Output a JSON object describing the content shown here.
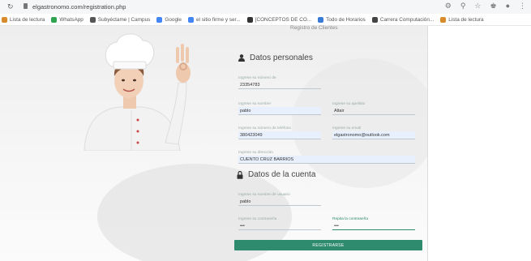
{
  "browser": {
    "url": "elgastronomo.com/registration.php",
    "bookmarks": [
      {
        "label": "Lista de lectura",
        "color": "#d98b2b"
      },
      {
        "label": "WhatsApp",
        "color": "#2ea44f"
      },
      {
        "label": "Subyéctame | Campus",
        "color": "#555555"
      },
      {
        "label": "Google",
        "color": "#4285f4"
      },
      {
        "label": "el sitio firme y ser...",
        "color": "#4285f4"
      },
      {
        "label": "[CONCEPTOS DE CO...",
        "color": "#333333"
      },
      {
        "label": "Todo de Horarios",
        "color": "#3a7bd5"
      },
      {
        "label": "Carrera Computación...",
        "color": "#444444"
      },
      {
        "label": "Lista de lectura",
        "color": "#d98b2b"
      }
    ]
  },
  "page": {
    "heading": "Registro de Clientes"
  },
  "form": {
    "personal": {
      "title": "Datos personales",
      "fields": [
        {
          "label": "Ingrese su número de",
          "value": "23354783"
        },
        {
          "label": "Ingrese su nombre",
          "value": "pablo"
        },
        {
          "label": "Ingrese su apellido",
          "value": "Altair"
        },
        {
          "label": "Ingrese su número de teléfono",
          "value": "380423049"
        },
        {
          "label": "Ingrese su email",
          "value": "elgastronomo@outlook.com"
        },
        {
          "label": "Ingrese su dirección",
          "value": "CUENTO CRUZ BARRIOS"
        }
      ]
    },
    "account": {
      "title": "Datos de la cuenta",
      "fields": [
        {
          "label": "Ingrese su nombre de usuario",
          "value": "pablo"
        },
        {
          "label": "Ingrese su contraseña",
          "value": "•••"
        },
        {
          "label": "Repita la contraseña",
          "value": "•••"
        }
      ]
    },
    "submit_label": "REGISTRARSE"
  },
  "colors": {
    "accent": "#2e8b6e",
    "autofill": "#e8f0fe"
  }
}
